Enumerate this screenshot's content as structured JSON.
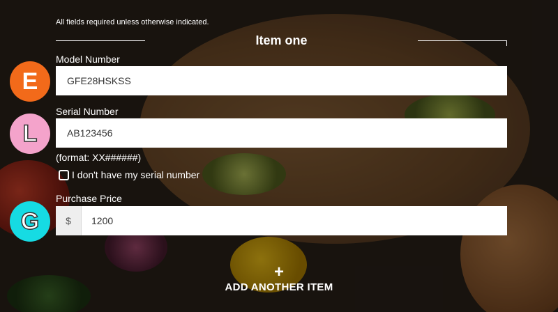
{
  "form": {
    "note": "All fields required unless otherwise indicated.",
    "section_title": "Item one",
    "model": {
      "label": "Model Number",
      "value": "GFE28HSKSS",
      "badge": "E",
      "badge_color": "#f26a1a"
    },
    "serial": {
      "label": "Serial Number",
      "value": "AB123456",
      "badge": "L",
      "badge_color": "#f4a3cb",
      "format_hint": "(format: XX######)"
    },
    "no_serial_checkbox": {
      "label": "I don't have my serial number",
      "checked": false
    },
    "price": {
      "label": "Purchase Price",
      "prefix": "$",
      "value": "1200",
      "badge": "G",
      "badge_color": "#16dbe3"
    },
    "add_another": {
      "icon": "plus-icon",
      "plus": "+",
      "label": "ADD ANOTHER ITEM"
    }
  }
}
